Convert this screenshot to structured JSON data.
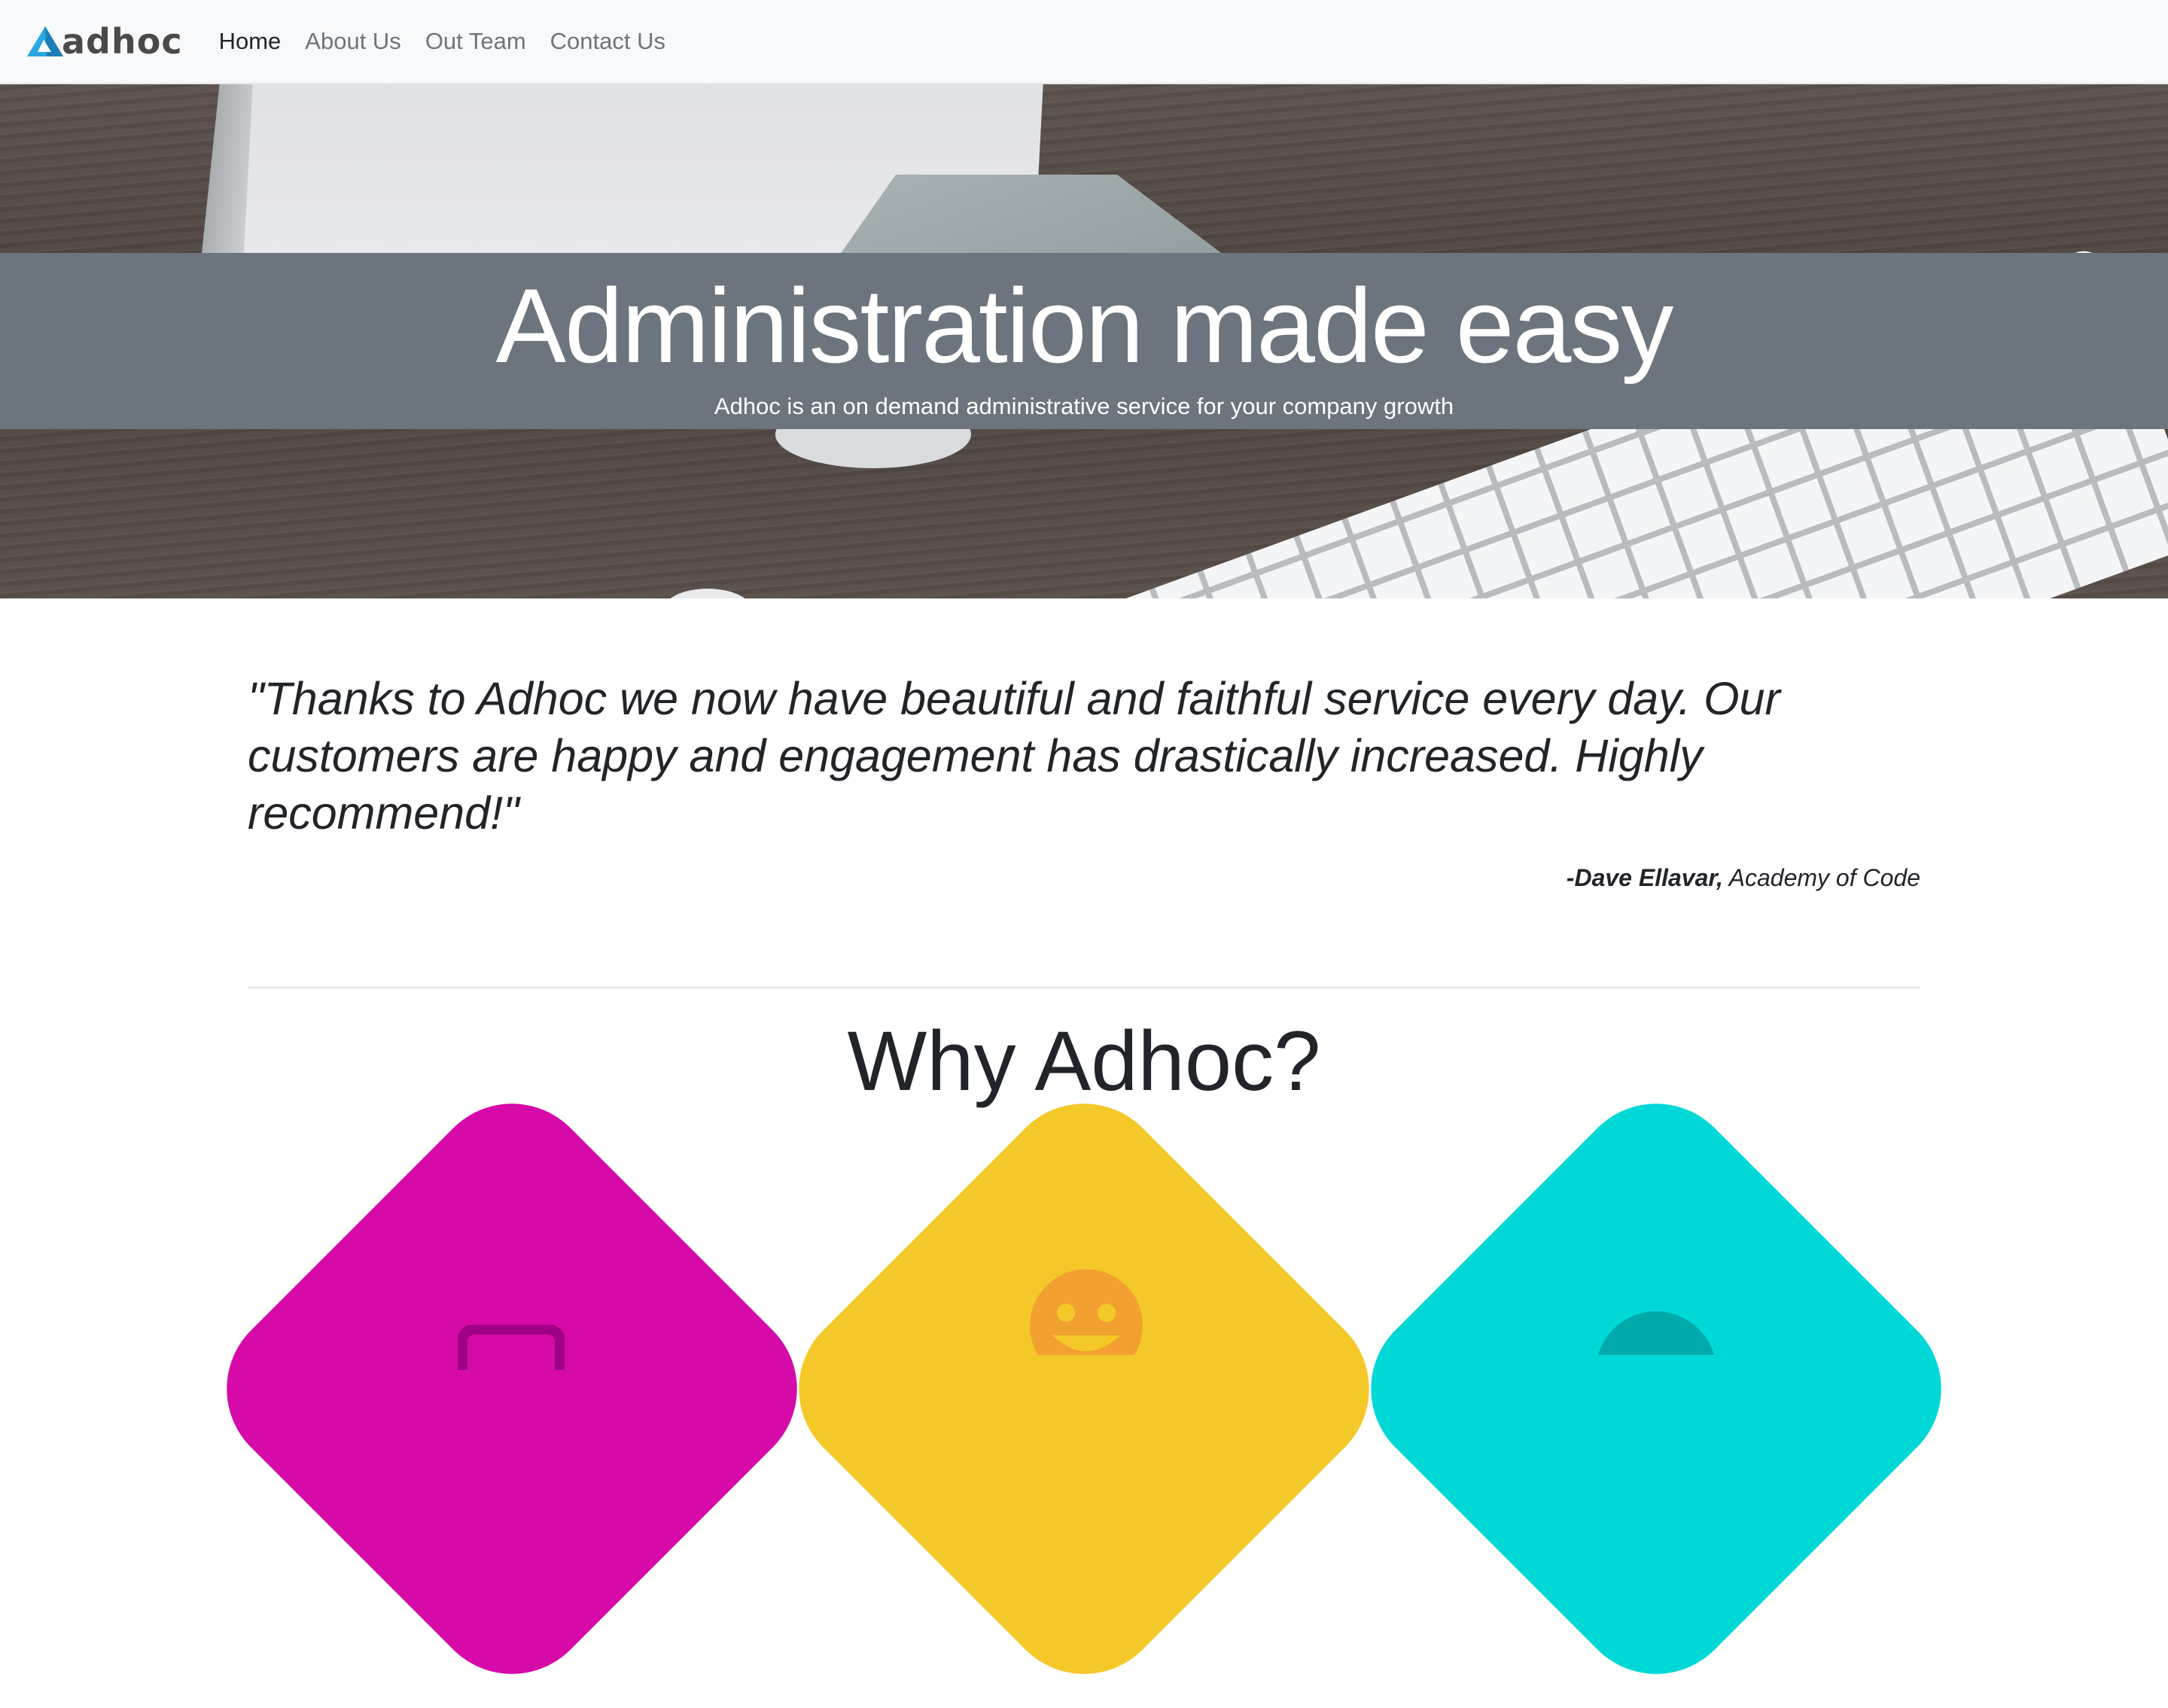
{
  "brand": {
    "name": "adhoc",
    "logo_icon": "triangle-logo-icon",
    "colors": {
      "logo_primary": "#29a8e0",
      "logo_secondary": "#1d7fb8",
      "text": "#4a4a4a"
    }
  },
  "nav": {
    "items": [
      {
        "label": "Home",
        "active": true
      },
      {
        "label": "About Us",
        "active": false
      },
      {
        "label": "Out Team",
        "active": false
      },
      {
        "label": "Contact Us",
        "active": false
      }
    ]
  },
  "hero": {
    "title": "Administration made easy",
    "subtitle": "Adhoc is an on demand administrative service for your company growth",
    "band_color": "#6c757d"
  },
  "testimonial": {
    "quote": "\"Thanks to Adhoc we now have beautiful and faithful service every day. Our customers are happy and engagement has drastically increased. Highly recommend!\"",
    "author": "-Dave Ellavar,",
    "company": "Academy of Code"
  },
  "why": {
    "title": "Why Adhoc?",
    "features": [
      {
        "color": "#d60aa8",
        "icon": "briefcase-icon"
      },
      {
        "color": "#f4c829",
        "icon": "smiley-face-icon"
      },
      {
        "color": "#00d8d8",
        "icon": "user-circle-icon"
      }
    ]
  }
}
